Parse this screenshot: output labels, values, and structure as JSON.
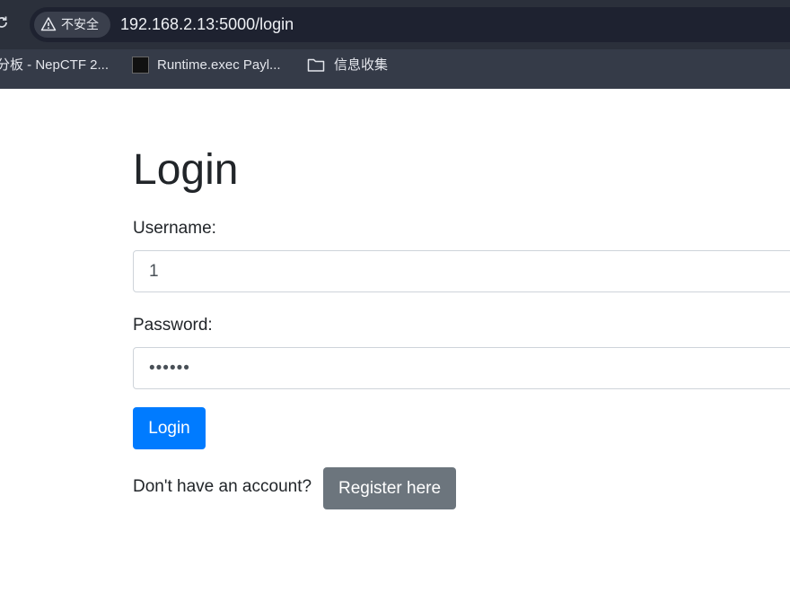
{
  "browser": {
    "security_label": "不安全",
    "url": "192.168.2.13:5000/login",
    "bookmarks": [
      {
        "label": "分板 - NepCTF 2..."
      },
      {
        "label": "Runtime.exec Payl..."
      },
      {
        "label": "信息收集"
      }
    ]
  },
  "page": {
    "title": "Login",
    "username_label": "Username:",
    "username_value": "1",
    "password_label": "Password:",
    "password_value": "••••••",
    "login_button": "Login",
    "register_prompt": "Don't have an account?",
    "register_button": "Register here"
  },
  "colors": {
    "primary": "#007bff",
    "secondary": "#6c757d",
    "chrome": "#353b48"
  }
}
